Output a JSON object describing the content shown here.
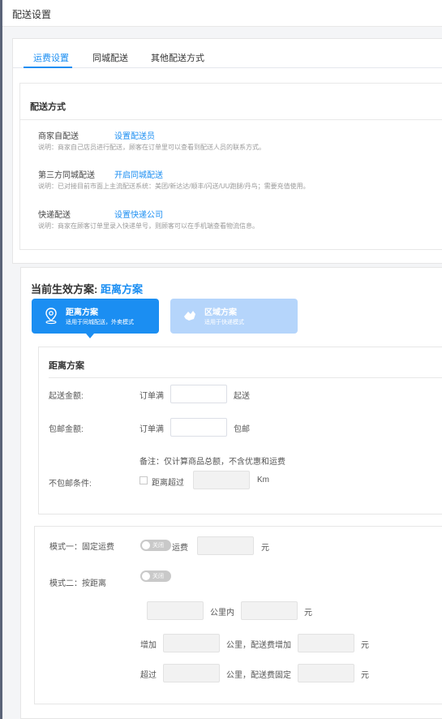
{
  "window": {
    "title": "配送设置"
  },
  "tabs": [
    {
      "label": "运费设置",
      "active": true
    },
    {
      "label": "同城配送",
      "active": false
    },
    {
      "label": "其他配送方式",
      "active": false
    }
  ],
  "delivery": {
    "title": "配送方式",
    "items": [
      {
        "name": "商家自配送",
        "action": "设置配送员",
        "note": "说明：商家自己店员进行配送，顾客在订单里可以查看到配送人员的联系方式。"
      },
      {
        "name": "第三方同城配送",
        "action": "开启同城配送",
        "note": "说明：已对接目前市面上主流配送系统：美团/新达达/顺丰/闪送/UU跑腿/丹鸟；需要充值使用。"
      },
      {
        "name": "快递配送",
        "action": "设置快递公司",
        "note": "说明：商家在顾客订单里录入快递单号，则顾客可以在手机端查看物流信息。"
      }
    ]
  },
  "plan": {
    "current_label": "当前生效方案:",
    "current_name": "距离方案",
    "cards": [
      {
        "title": "距离方案",
        "subtitle": "适用于同城配送，外卖模式",
        "selected": true
      },
      {
        "title": "区域方案",
        "subtitle": "适用于快递模式",
        "selected": false
      }
    ]
  },
  "distance": {
    "title": "距离方案",
    "start_label": "起送金额:",
    "order_full": "订单满",
    "start_suffix": "起送",
    "free_label": "包邮金额:",
    "free_suffix": "包邮",
    "remark": "备注：仅计算商品总额，不含优惠和运费",
    "nofree_label": "不包邮条件:",
    "distance_over": "距离超过",
    "km": "Km"
  },
  "modes": {
    "mode1_label": "模式一：固定运费",
    "switch_off": "关闭",
    "fee": "运费",
    "yuan": "元",
    "mode2_label": "模式二：按距离",
    "within_km": "公里内",
    "increase": "增加",
    "km_fee_increase": "公里，配送费增加",
    "exceed": "超过",
    "km_fee_fixed": "公里，配送费固定"
  },
  "colors": {
    "accent": "#1b8ef2",
    "accent_light": "#b5d5fb"
  }
}
